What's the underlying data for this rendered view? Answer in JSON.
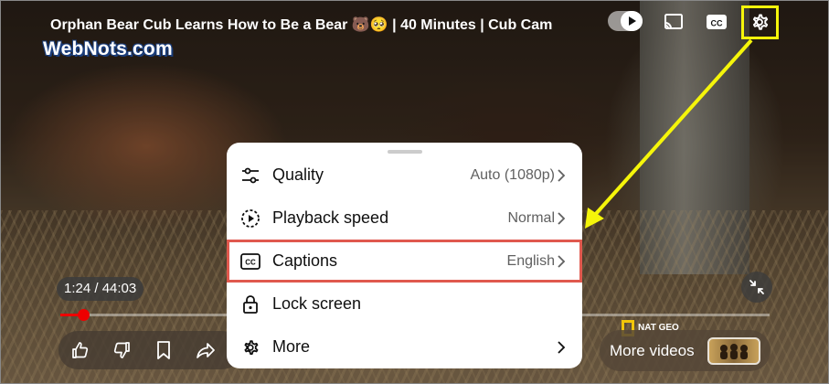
{
  "video": {
    "title": "Orphan Bear Cub Learns How to Be a Bear 🐻🥺 | 40 Minutes | Cub Cam",
    "time_display": "1:24 / 44:03",
    "progress_fraction": 0.032
  },
  "watermark": "WebNots.com",
  "top_controls": {
    "autoplay_icon": "play-icon",
    "cast_icon": "cast-icon",
    "captions_icon": "cc-icon",
    "settings_icon": "gear-icon"
  },
  "settings_menu": {
    "items": [
      {
        "label": "Quality",
        "value": "Auto (1080p)",
        "icon": "sliders-icon"
      },
      {
        "label": "Playback speed",
        "value": "Normal",
        "icon": "playback-speed-icon"
      },
      {
        "label": "Captions",
        "value": "English",
        "icon": "cc-icon"
      },
      {
        "label": "Lock screen",
        "value": "",
        "icon": "lock-icon"
      },
      {
        "label": "More",
        "value": "",
        "icon": "gear-icon"
      }
    ]
  },
  "action_bar": {
    "icons": [
      "thumbs-up-icon",
      "thumbs-down-icon",
      "save-icon",
      "share-icon"
    ]
  },
  "more_videos": {
    "label": "More videos"
  },
  "channel_logo": {
    "text": "NAT GEO"
  },
  "colors": {
    "annotation_yellow": "#f5f50a",
    "highlight_red": "#e0594e",
    "progress_red": "#ee0000"
  }
}
